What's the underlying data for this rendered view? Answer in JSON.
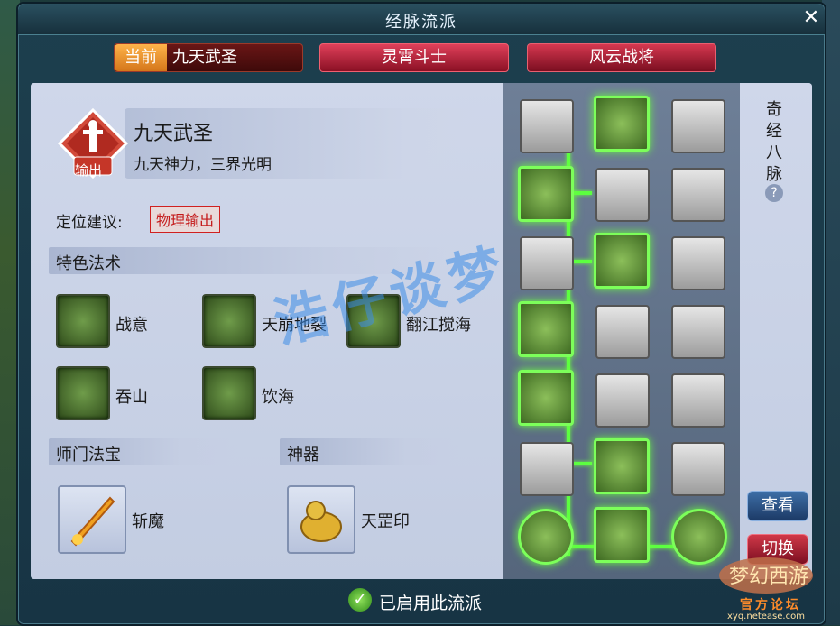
{
  "window": {
    "title": "经脉流派",
    "close_label": "✕"
  },
  "tabs": [
    {
      "badge": "当前",
      "label": "九天武圣"
    },
    {
      "label": "灵霄斗士"
    },
    {
      "label": "风云战将"
    }
  ],
  "sect": {
    "name": "九天武圣",
    "motto": "九天神力，三界光明",
    "icon_badge": "输出",
    "role_label": "定位建议:",
    "role_value": "物理输出"
  },
  "special_skills": {
    "header": "特色法术",
    "items": [
      {
        "label": "战意",
        "icon": "swirl-icon"
      },
      {
        "label": "天崩地裂",
        "icon": "mountain-icon"
      },
      {
        "label": "翻江搅海",
        "icon": "wave-icon"
      },
      {
        "label": "吞山",
        "icon": "burst-icon"
      },
      {
        "label": "饮海",
        "icon": "sea-icon"
      }
    ]
  },
  "treasure": {
    "header": "师门法宝",
    "label": "斩魔"
  },
  "artifact": {
    "header": "神器",
    "label": "天罡印"
  },
  "meridian": {
    "title": "奇经八脉",
    "help_label": "?",
    "view_button": "查看",
    "switch_button": "切换"
  },
  "footer": {
    "text": "已启用此流派"
  },
  "watermark": "浩仔谈梦",
  "logo": {
    "title": "官方论坛",
    "url": "xyq.netease.com"
  },
  "colors": {
    "accent_green": "#5cff40",
    "tab_red": "#d63850",
    "badge_orange": "#ffb34a",
    "role_red": "#c41a1a"
  }
}
